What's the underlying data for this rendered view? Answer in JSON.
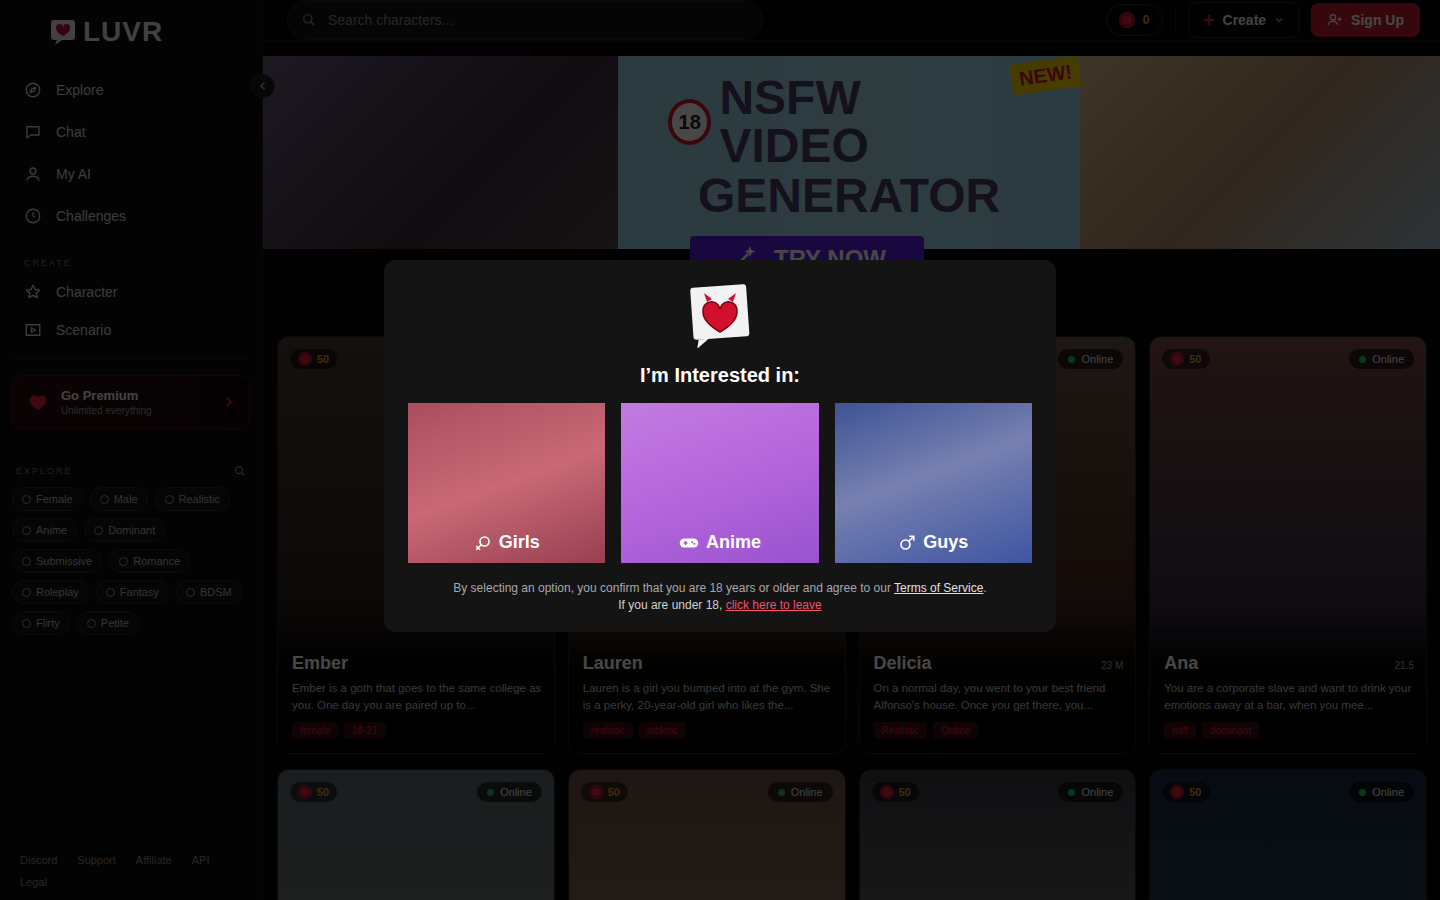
{
  "logo": {
    "text": "LUVR"
  },
  "sidebar": {
    "nav": [
      {
        "label": "Explore",
        "selected": false
      },
      {
        "label": "Chat",
        "selected": false
      },
      {
        "label": "My AI",
        "selected": false
      },
      {
        "label": "Challenges",
        "selected": false
      }
    ],
    "create_heading": "CREATE",
    "create": [
      "Character",
      "Scenario"
    ],
    "premium": {
      "title": "Go Premium",
      "subtitle": "Unlimited everything"
    },
    "explore_heading": "EXPLORE",
    "tags": [
      "Female",
      "Male",
      "Realistic",
      "Anime",
      "Dominant",
      "Submissive",
      "Romance",
      "Roleplay",
      "Fantasy",
      "BDSM",
      "Flirty",
      "Petite"
    ],
    "footer": [
      "Discord",
      "Support",
      "Affiliate",
      "API",
      "Legal"
    ]
  },
  "topbar": {
    "search_placeholder": "Search characters...",
    "coins": "0",
    "create": "Create",
    "signup": "Sign Up"
  },
  "banner": {
    "badge": "18",
    "title_line1": "NSFW VIDEO",
    "title_line2": "GENERATOR",
    "new": "NEW!",
    "cta": "TRY NOW"
  },
  "cards": [
    {
      "coins": "50",
      "name": "Ember",
      "description": "Ember is a goth that goes to the same college as you. One day you are paired up to...",
      "tags": [
        "female",
        "18-21"
      ]
    },
    {
      "name": "Lauren",
      "description": "Lauren is a girl you bumped into at the gym. She is a perky, 20-year-old girl who likes the...",
      "tags": [
        "realistic",
        "athletic"
      ]
    },
    {
      "online": "Online",
      "name": "Delicia",
      "stat": "23 M",
      "description": "On a normal day, you went to your best friend Alfonso's house. Once you get there, you...",
      "tags": [
        "Realistic",
        "Online"
      ]
    },
    {
      "coins": "50",
      "online": "Online",
      "name": "Ana",
      "stat": "21.5",
      "description": "You are a corporate slave and want to drink your emotions away at a bar, when you mee...",
      "tags": [
        "milf",
        "dominant"
      ]
    },
    {
      "coins": "50",
      "online": "Online"
    },
    {
      "coins": "50",
      "online": "Online"
    },
    {
      "coins": "50",
      "online": "Online"
    },
    {
      "coins": "50",
      "online": "Online"
    }
  ],
  "modal": {
    "title": "I’m Interested in:",
    "options": [
      {
        "label": "Girls",
        "color": "#d0506f"
      },
      {
        "label": "Anime",
        "color": "#b060d8"
      },
      {
        "label": "Guys",
        "color": "#4a68c0"
      }
    ],
    "disclaimer_before": "By selecting an option, you confirm that you are 18 years or older and agree to our ",
    "terms_link": "Terms of Service",
    "disclaimer_after": ".",
    "under_text": "If you are under 18, ",
    "leave_link": "click here to leave"
  }
}
